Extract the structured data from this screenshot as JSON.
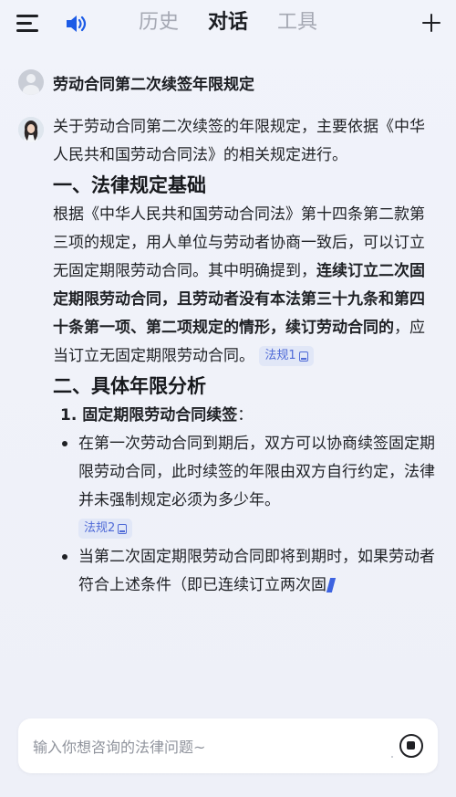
{
  "header": {
    "tabs": [
      {
        "label": "历史",
        "active": false
      },
      {
        "label": "对话",
        "active": true
      },
      {
        "label": "工具",
        "active": false
      }
    ],
    "icons": {
      "menu": "menu-icon",
      "speaker": "speaker-icon",
      "new_chat": "plus-icon"
    },
    "accent_color": "#1c5be6"
  },
  "conversation": {
    "user_question": "劳动合同第二次续签年限规定",
    "answer": {
      "intro": "关于劳动合同第二次续签的年限规定，主要依据《中华人民共和国劳动合同法》的相关规定进行。",
      "section1_title": "一、法律规定基础",
      "section1_text_a": "根据《中华人民共和国劳动合同法》第十四条第二款第三项的规定，用人单位与劳动者协商一致后，可以订立无固定期限劳动合同。其中明确提到，",
      "section1_text_bold": "连续订立二次固定期限劳动合同，且劳动者没有本法第三十九条和第四十条第一项、第二项规定的情形，续订劳动合同的",
      "section1_text_b": "，应当订立无固定期限劳动合同。",
      "ref1": "法规1",
      "section2_title": "二、具体年限分析",
      "item1_num": "1.",
      "item1_title": "固定期限劳动合同续签",
      "item1_colon": "：",
      "bullet1": "在第一次劳动合同到期后，双方可以协商续签固定期限劳动合同，此时续签的年限由双方自行约定，法律并未强制规定必须为多少年。",
      "ref2": "法规2",
      "bullet2": "当第二次固定期限劳动合同即将到期时，如果劳动者符合上述条件（即已连续订立两次固"
    }
  },
  "input": {
    "placeholder": "输入你想咨询的法律问题~",
    "value": ""
  },
  "colors": {
    "ref_tag_bg": "#e1e7f7",
    "ref_tag_text": "#4f6ad7"
  }
}
